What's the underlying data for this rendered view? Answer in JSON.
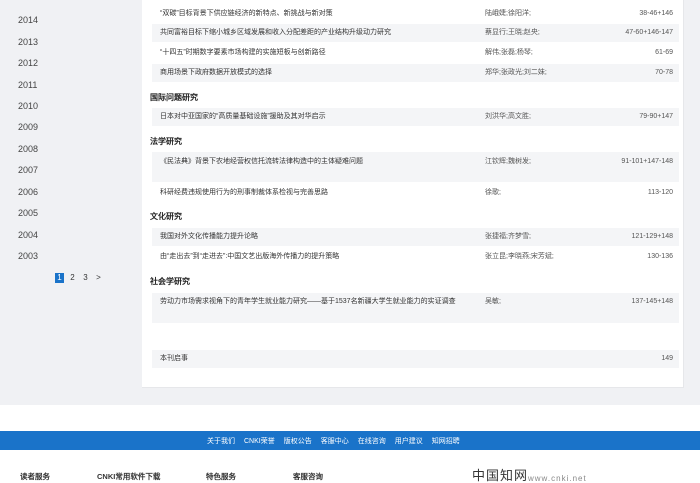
{
  "sidebar": {
    "years": [
      "2014",
      "2013",
      "2012",
      "2011",
      "2010",
      "2009",
      "2008",
      "2007",
      "2006",
      "2005",
      "2004",
      "2003"
    ],
    "pager": [
      "1",
      "2",
      "3",
      ">"
    ]
  },
  "articles": [
    {
      "title": "“双碳”目标背景下供应链经济的新特点、新挑战与新对策",
      "authors": "陆峨婕;徐阳洋;",
      "pages": "38-46+146"
    },
    {
      "title": "共同富裕目标下缩小城乡区域发展和收入分配差距的产业结构升级动力研究",
      "authors": "蔡显行;王晓;赵央;",
      "pages": "47-60+146-147"
    },
    {
      "title": "“十四五”时期数字要素市场构建的实施短板与创新路径",
      "authors": "解伟;张磊;杨琴;",
      "pages": "61-69"
    },
    {
      "title": "商用场景下政府数据开放模式的选择",
      "authors": "郑华;张政光;刘二妹;",
      "pages": "70-78"
    },
    {
      "title": "日本对中亚国家的“高质量基础设施”援助及其对华启示",
      "authors": "刘洪华;高文胜;",
      "pages": "79-90+147"
    },
    {
      "title": "《民法典》背景下农地经营权信托流转法律构造中的主体疑难问题",
      "authors": "江钦辉;魏树发;",
      "pages": "91-101+147-148"
    },
    {
      "title": "科研经费违规使用行为的刑事制裁体系检视与完善思路",
      "authors": "徐歌;",
      "pages": "113-120"
    },
    {
      "title": "我国对外文化传播能力提升论略",
      "authors": "张捷福;齐梦雪;",
      "pages": "121-129+148"
    },
    {
      "title": "由“走出去”到“走进去”:中国文艺出版海外传播力的提升策略",
      "authors": "张立昆;李晓燕;宋芳斌;",
      "pages": "130-136"
    },
    {
      "title": "劳动力市场需求视角下的青年学生就业能力研究——基于1537名新疆大学生就业能力的实证调查",
      "authors": "吴敏;",
      "pages": "137-145+148"
    },
    {
      "title": "本刊启事",
      "authors": "",
      "pages": "149"
    }
  ],
  "sections": {
    "intl": "国际问题研究",
    "law": "法学研究",
    "culture": "文化研究",
    "social": "社会学研究"
  },
  "footer": {
    "links": [
      "关于我们",
      "CNKI荣誉",
      "版权公告",
      "客服中心",
      "在线咨询",
      "用户建议",
      "知网招聘"
    ],
    "columns": [
      "读者服务",
      "CNKI常用软件下载",
      "特色服务",
      "客服咨询"
    ],
    "logo": "中国知网",
    "logo_url": "www.cnki.net"
  },
  "colors": {
    "accent": "#1a73c9",
    "row_shade": "#f4f5f7",
    "bg": "#f0f1f4"
  }
}
